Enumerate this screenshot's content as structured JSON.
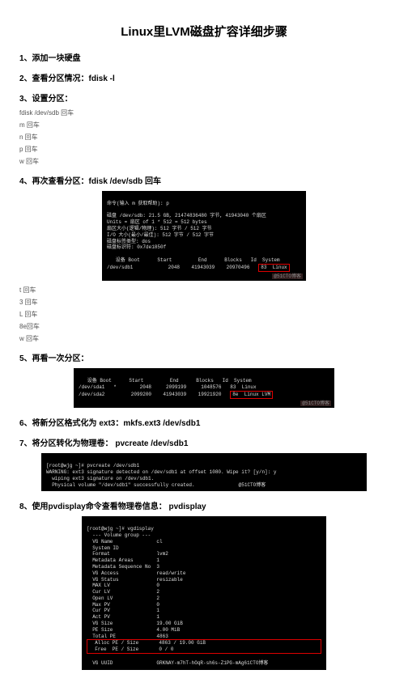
{
  "title": "Linux里LVM磁盘扩容详细步骤",
  "s1": "1、添加一块硬盘",
  "s2": "2、查看分区情况：fdisk -l",
  "s3": "3、设置分区：",
  "sub1": "fdisk /dev/sdb 回车",
  "sub2": "m 回车",
  "sub3": "n 回车",
  "sub4": "p 回车",
  "sub5": "w 回车",
  "s4": "4、再次查看分区：fdisk /dev/sdb 回车",
  "term1": {
    "l1": "命令(输入 m 获取帮助): p",
    "l2": "",
    "l3": "磁盘 /dev/sdb: 21.5 GB, 21474836480 字节, 41943040 个扇区",
    "l4": "Units = 扇区 of 1 * 512 = 512 bytes",
    "l5": "扇区大小(逻辑/物理): 512 字节 / 512 字节",
    "l6": "I/O 大小(最小/最佳): 512 字节 / 512 字节",
    "l7": "磁盘标签类型: dos",
    "l8": "磁盘标识符: 0x7de1850f",
    "l9": "",
    "l10": "   设备 Boot      Start         End      Blocks   Id  System",
    "l11": "/dev/sdb1            2048    41943039    20970496   83  Linux",
    "hl": "83  Linux"
  },
  "sub6": "t 回车",
  "sub7": "3 回车",
  "sub8": "L 回车",
  "sub9": "8e回车",
  "sub10": "w 回车",
  "s5": "5、再看一次分区：",
  "term2": {
    "l1": "   设备 Boot      Start         End      Blocks   Id  System",
    "l2": "/dev/sda1   *        2048     2099199     1048576   83  Linux",
    "l3": "/dev/sda2         2099200    41943039    19921920   8e  Linux LVM",
    "hl": "8e  Linux LVM"
  },
  "s6": "6、将新分区格式化为 ext3：mkfs.ext3 /dev/sdb1",
  "s7": "7、将分区转化为物理卷： pvcreate /dev/sdb1",
  "term3": {
    "l1": "[root@wjg ~]# pvcreate /dev/sdb1",
    "l2": "WARNING: ext3 signature detected on /dev/sdb1 at offset 1080. Wipe it? [y/n]: y",
    "l3": "  wiping ext3 signature on /dev/sdb1.",
    "l4": "  Physical volume \"/dev/sdb1\" successfully created.               @51CTO博客"
  },
  "s8": "8、使用pvdisplay命令查看物理卷信息： pvdisplay",
  "term4": {
    "l0": "[root@wjg ~]# vgdisplay",
    "l1": "  --- Volume group ---",
    "l2": "  VG Name               cl",
    "l3": "  System ID",
    "l4": "  Format                lvm2",
    "l5": "  Metadata Areas        1",
    "l6": "  Metadata Sequence No  3",
    "l7": "  VG Access             read/write",
    "l8": "  VG Status             resizable",
    "l9": "  MAX LV                0",
    "l10": "  Cur LV                2",
    "l11": "  Open LV               2",
    "l12": "  Max PV                0",
    "l13": "  Cur PV                1",
    "l14": "  Act PV                1",
    "l15": "  VG Size               19.00 GiB",
    "l16": "  PE Size               4.00 MiB",
    "l17": "  Total PE              4863",
    "l18": "  Alloc PE / Size       4863 / 19.00 GiB",
    "l19": "  Free  PE / Size       0 / 0",
    "l20": "  VG UUID               GRKNAY-m7hT-hOqR-sh6s-Z1PG-mAg61CTO博客"
  },
  "watermark": "@51CTO博客"
}
